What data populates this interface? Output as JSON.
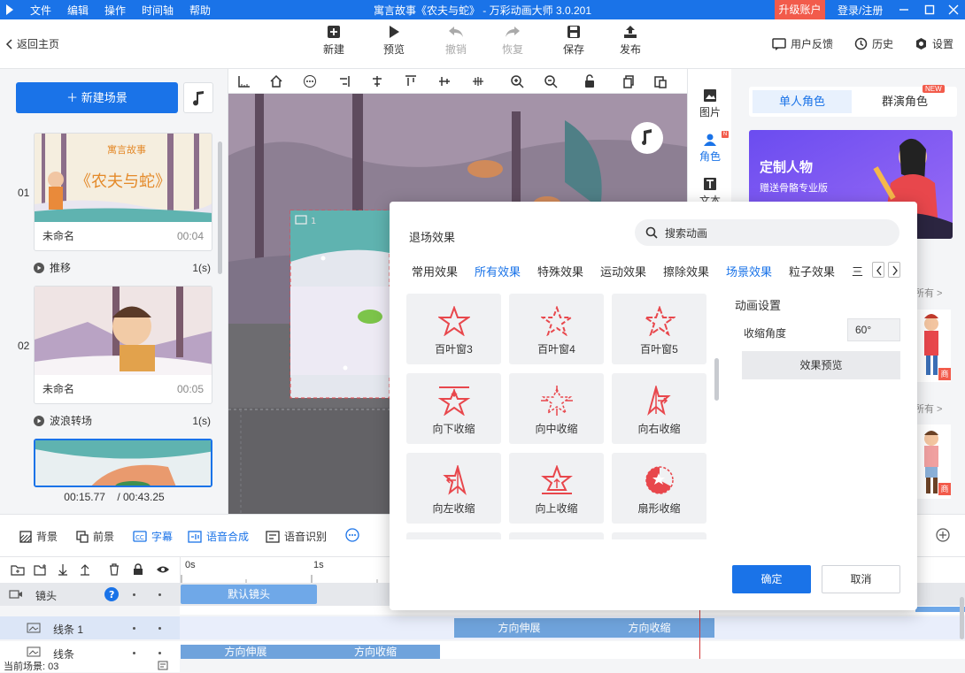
{
  "app": {
    "title": "寓言故事《农夫与蛇》 - 万彩动画大师 3.0.201",
    "menu": [
      "文件",
      "编辑",
      "操作",
      "时间轴",
      "帮助"
    ],
    "upgrade": "升级账户",
    "login": "登录/注册"
  },
  "toolbar": {
    "back": "返回主页",
    "buttons": [
      {
        "label": "新建",
        "icon": "plus-square-icon",
        "enabled": true
      },
      {
        "label": "预览",
        "icon": "play-icon",
        "enabled": true
      },
      {
        "label": "撤销",
        "icon": "undo-icon",
        "enabled": false
      },
      {
        "label": "恢复",
        "icon": "redo-icon",
        "enabled": false
      },
      {
        "label": "保存",
        "icon": "save-icon",
        "enabled": true
      },
      {
        "label": "发布",
        "icon": "publish-icon",
        "enabled": true
      }
    ],
    "right": [
      "用户反馈",
      "历史",
      "设置"
    ]
  },
  "scenes": {
    "new_scene": "新建场景",
    "items": [
      {
        "num": "01",
        "name": "未命名",
        "duration": "00:04",
        "transition": "推移",
        "transition_time": "1(s)",
        "caption_top": "寓言故事",
        "caption_main": "《农夫与蛇》"
      },
      {
        "num": "02",
        "name": "未命名",
        "duration": "00:05",
        "transition": "波浪转场",
        "transition_time": "1(s)"
      }
    ],
    "current_time": "00:15.77",
    "total_time": "/ 00:43.25"
  },
  "canvas": {
    "element_label": "1"
  },
  "side_tabs": [
    "图片",
    "角色",
    "文本"
  ],
  "right_panel": {
    "tab_single": "单人角色",
    "tab_group": "群演角色",
    "new_badge": "NEW",
    "banner_title": "定制人物",
    "banner_sub": "赠送骨骼专业版",
    "all_label_1": "所有 >",
    "all_label_2": "所有 >",
    "shop_badge": "商"
  },
  "dialog": {
    "title": "退场效果",
    "search_placeholder": "搜索动画",
    "categories": [
      "常用效果",
      "所有效果",
      "特殊效果",
      "运动效果",
      "擦除效果",
      "场景效果",
      "粒子效果",
      "三"
    ],
    "active_category": "所有效果",
    "effects": [
      {
        "label": "百叶窗3",
        "icon": "star-blinds-icon"
      },
      {
        "label": "百叶窗4",
        "icon": "star-blinds-icon"
      },
      {
        "label": "百叶窗5",
        "icon": "star-blinds-icon"
      },
      {
        "label": "向下收缩",
        "icon": "star-shrink-down-icon"
      },
      {
        "label": "向中收缩",
        "icon": "star-shrink-center-icon"
      },
      {
        "label": "向右收缩",
        "icon": "star-shrink-right-icon"
      },
      {
        "label": "向左收缩",
        "icon": "star-shrink-left-icon"
      },
      {
        "label": "向上收缩",
        "icon": "star-shrink-up-icon"
      },
      {
        "label": "扇形收缩",
        "icon": "star-fan-icon"
      }
    ],
    "settings_title": "动画设置",
    "shrink_angle_label": "收缩角度",
    "shrink_angle_value": "60°",
    "preview": "效果预览",
    "ok": "确定",
    "cancel": "取消"
  },
  "timeline": {
    "tabs": [
      {
        "label": "背景",
        "active": false
      },
      {
        "label": "前景",
        "active": false
      },
      {
        "label": "字幕",
        "active": true
      },
      {
        "label": "语音合成",
        "active": true
      },
      {
        "label": "语音识别",
        "active": false
      }
    ],
    "ruler": [
      "0s",
      "1s"
    ],
    "tracks": [
      {
        "name": "镜头",
        "clips": [
          "默认镜头"
        ]
      },
      {
        "name": "线条 1",
        "clips": [
          "方向伸展",
          "方向收缩"
        ]
      },
      {
        "name": "线条",
        "clips": [
          "方向伸展",
          "方向收缩"
        ]
      }
    ],
    "current_scene": "当前场景: 03"
  },
  "colors": {
    "accent": "#1a73e8",
    "upgrade": "#f25b4b",
    "effect_icon": "#e8474c"
  }
}
